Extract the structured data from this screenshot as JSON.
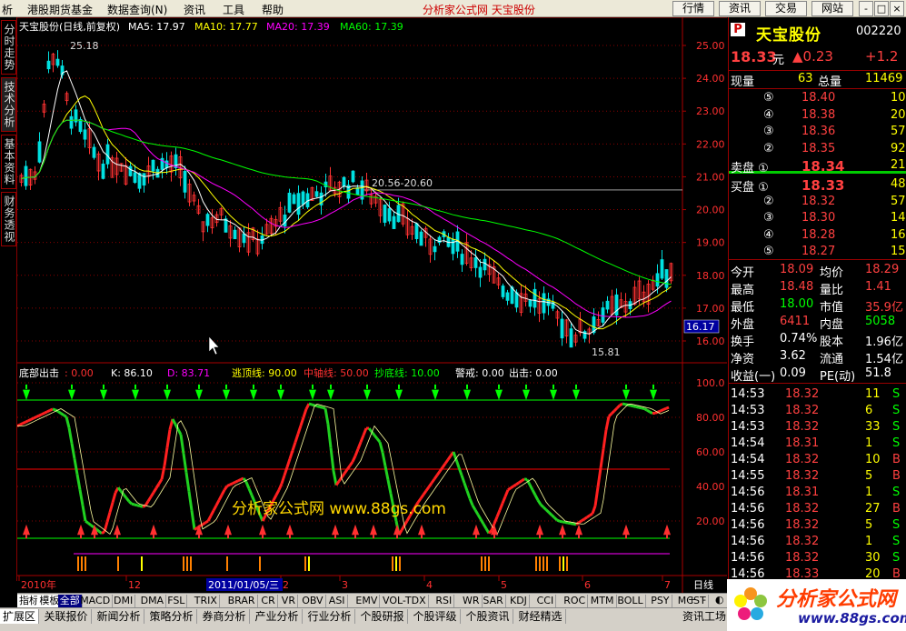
{
  "menu": {
    "items": [
      "析",
      "港股期货基金",
      "数据查询(N)",
      "资讯",
      "工具",
      "帮助"
    ],
    "title": "分析家公式网  天宝股份",
    "buttons": [
      "行情",
      "资讯",
      "交易",
      "网站"
    ],
    "win_buttons": [
      "-",
      "□",
      "×"
    ]
  },
  "left_tabs": [
    "分时走势",
    "技术分析",
    "基本资料",
    "财务透视"
  ],
  "main": {
    "header_name": "天宝股份(日线,前复权)",
    "ma5": "MA5: 17.97",
    "ma10": "MA10: 17.77",
    "ma20": "MA20: 17.39",
    "ma60": "MA60: 17.39",
    "high_label": "25.18",
    "low_label": "15.81",
    "range_label": "20.56-20.60",
    "cursor_value": "16.17",
    "price_ticks": [
      "25.00",
      "24.00",
      "23.00",
      "22.00",
      "21.00",
      "20.00",
      "19.00",
      "18.00",
      "17.00",
      "16.00"
    ],
    "colors": {
      "up": "#ff3232",
      "down": "#00e0e0",
      "ma5": "#ffffff",
      "ma10": "#ffff00",
      "ma20": "#ff00ff",
      "ma60": "#00ff00"
    }
  },
  "indicator": {
    "name": "底部出击",
    "value": ": 0.00",
    "k": "K: 86.10",
    "d": "D: 83.71",
    "escape": "逃顶线: 90.00",
    "mid": "中轴线: 50.00",
    "bottom": "抄底线: 10.00",
    "warn": "警戒: 0.00",
    "out": "出击: 0.00",
    "ticks": [
      "100.0",
      "80.00",
      "60.00",
      "40.00",
      "20.00"
    ],
    "watermark": "分析家公式网 www.88gs.com"
  },
  "date_axis": {
    "labels": [
      "2010年",
      "12",
      "2",
      "3",
      "4",
      "5",
      "6",
      "7"
    ],
    "cursor_date": "2011/01/05/三",
    "period": "日线"
  },
  "right_panel": {
    "code_flag": "P",
    "name": "天宝股份",
    "code": "002220",
    "price": "18.33",
    "price_unit": "元",
    "change": "▲0.23",
    "pct": "+1.2",
    "volume_now_label": "现量",
    "volume_now": "63",
    "total_label": "总量",
    "total": "11469",
    "sells": [
      {
        "lvl": "⑤",
        "p": "18.40",
        "v": "10"
      },
      {
        "lvl": "④",
        "p": "18.38",
        "v": "20"
      },
      {
        "lvl": "③",
        "p": "18.36",
        "v": "57"
      },
      {
        "lvl": "②",
        "p": "18.35",
        "v": "92"
      },
      {
        "lvl": "卖盘 ①",
        "p": "18.34",
        "v": "21"
      }
    ],
    "buys": [
      {
        "lvl": "买盘 ①",
        "p": "18.33",
        "v": "48"
      },
      {
        "lvl": "②",
        "p": "18.32",
        "v": "57"
      },
      {
        "lvl": "③",
        "p": "18.30",
        "v": "14"
      },
      {
        "lvl": "④",
        "p": "18.28",
        "v": "16"
      },
      {
        "lvl": "⑤",
        "p": "18.27",
        "v": "15"
      }
    ],
    "stats": [
      {
        "l1": "今开",
        "v1": "18.09",
        "l2": "均价",
        "v2": "18.29"
      },
      {
        "l1": "最高",
        "v1": "18.48",
        "l2": "量比",
        "v2": "1.41"
      },
      {
        "l1": "最低",
        "v1": "18.00",
        "l2": "市值",
        "v2": "35.9亿"
      },
      {
        "l1": "外盘",
        "v1": "6411",
        "l2": "内盘",
        "v2": "5058"
      },
      {
        "l1": "换手",
        "v1": "0.74%",
        "l2": "股本",
        "v2": "1.96亿"
      },
      {
        "l1": "净资",
        "v1": "3.62",
        "l2": "流通",
        "v2": "1.54亿"
      },
      {
        "l1": "收益(一)",
        "v1": "0.09",
        "l2": "PE(动)",
        "v2": "51.8"
      }
    ],
    "ticks": [
      {
        "t": "14:53",
        "p": "18.32",
        "v": "11",
        "s": "S"
      },
      {
        "t": "14:53",
        "p": "18.32",
        "v": "6",
        "s": "S"
      },
      {
        "t": "14:53",
        "p": "18.32",
        "v": "33",
        "s": "S"
      },
      {
        "t": "14:54",
        "p": "18.31",
        "v": "1",
        "s": "S"
      },
      {
        "t": "14:54",
        "p": "18.32",
        "v": "10",
        "s": "B"
      },
      {
        "t": "14:55",
        "p": "18.32",
        "v": "5",
        "s": "B"
      },
      {
        "t": "14:56",
        "p": "18.31",
        "v": "1",
        "s": "S"
      },
      {
        "t": "14:56",
        "p": "18.32",
        "v": "27",
        "s": "B"
      },
      {
        "t": "14:56",
        "p": "18.32",
        "v": "5",
        "s": "S"
      },
      {
        "t": "14:56",
        "p": "18.32",
        "v": "1",
        "s": "S"
      },
      {
        "t": "14:56",
        "p": "18.32",
        "v": "30",
        "s": "S"
      },
      {
        "t": "14:56",
        "p": "18.33",
        "v": "20",
        "s": "B"
      }
    ]
  },
  "indicator_tabs": [
    "指标",
    "模板",
    "全部",
    "MACD",
    "DMI",
    "DMA",
    "FSL",
    "TRIX",
    "BRAR",
    "CR",
    "VR",
    "OBV",
    "ASI",
    "EMV",
    "VOL-TDX",
    "RSI",
    "WR",
    "SAR",
    "KDJ",
    "CCI",
    "ROC",
    "MTM",
    "BOLL",
    "PSY",
    "MCST"
  ],
  "indicator_tab_right": [
    "+",
    "-",
    "◐"
  ],
  "bottom_tabs": [
    "扩展区",
    "关联报价",
    "新闻分析",
    "策略分析",
    "券商分析",
    "产业分析",
    "行业分析",
    "个股研报",
    "个股评级",
    "个股资讯",
    "财经精选"
  ],
  "bottom_right_tab": "资讯工场",
  "logo": {
    "text": "分析家公式网",
    "url": "www.88gs.com"
  }
}
